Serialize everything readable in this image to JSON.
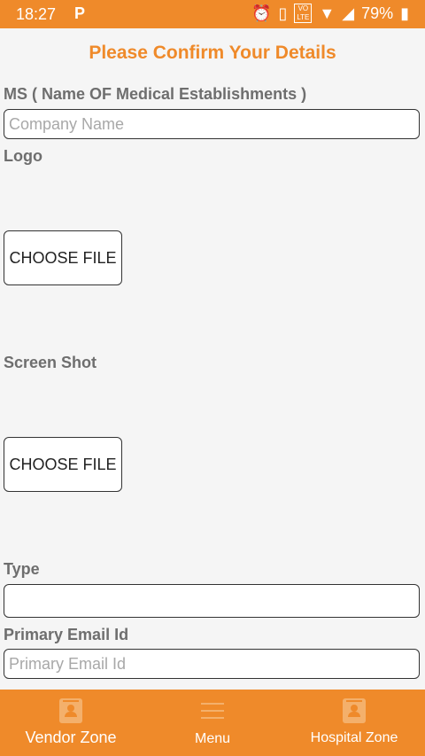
{
  "status_bar": {
    "time": "18:27",
    "battery": "79%",
    "volte_top": "VO",
    "volte_bottom": "LTE"
  },
  "page_title": "Please Confirm Your Details",
  "form": {
    "ms_label": "MS ( Name OF Medical Establishments )",
    "company_placeholder": "Company Name",
    "logo_label": "Logo",
    "choose_file_label": "CHOOSE FILE",
    "screenshot_label": "Screen Shot",
    "type_label": "Type",
    "type_value": "",
    "primary_email_label": "Primary Email Id",
    "primary_email_placeholder": "Primary Email Id"
  },
  "bottom_nav": {
    "vendor_zone": "Vendor Zone",
    "menu": "Menu",
    "hospital_zone": "Hospital Zone"
  },
  "colors": {
    "accent": "#ef8a2a",
    "label": "#6e6e6e"
  }
}
